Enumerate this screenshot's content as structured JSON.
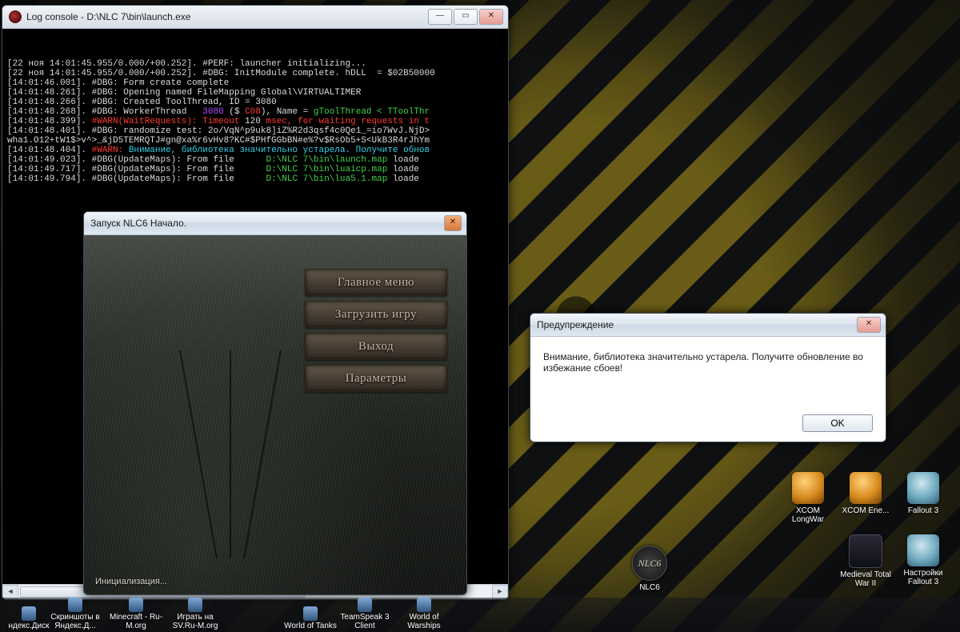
{
  "console": {
    "title": "Log console - D:\\NLC 7\\bin\\launch.exe",
    "lines": [
      {
        "ts": "[22 ноя 14:01:45.955/0.000/+00.252]. ",
        "tag": "#PERF:",
        "tagClass": "c-perf",
        "rest": " launcher initializing..."
      },
      {
        "ts": "[22 ноя 14:01:45.955/0.000/+00.252]. ",
        "tag": "#DBG:",
        "tagClass": "c-dbg",
        "rest": " InitModule complete. hDLL  = $02B50000"
      },
      {
        "ts": "[14:01:46.001]. ",
        "tag": "#DBG:",
        "tagClass": "c-dbg",
        "rest": " Form create complete"
      },
      {
        "ts": "[14:01:48.261]. ",
        "tag": "#DBG:",
        "tagClass": "c-dbg",
        "rest": " Opening named FileMapping Global\\VIRTUALTIMER"
      },
      {
        "ts": "[14:01:48.266]. ",
        "tag": "#DBG:",
        "tagClass": "c-dbg",
        "rest": " Created ToolThread, ID = 3080"
      },
      {
        "ts": "[14:01:48.268]. ",
        "tag": "#DBG:",
        "tagClass": "c-dbg",
        "segments": [
          {
            "t": " WorkerThread   ",
            "c": ""
          },
          {
            "t": "3080",
            "c": "c-num"
          },
          {
            "t": " ($ ",
            "c": ""
          },
          {
            "t": "C08",
            "c": "c-red"
          },
          {
            "t": "), Name = ",
            "c": ""
          },
          {
            "t": "gToolThread < TToolThr",
            "c": "c-name"
          }
        ]
      },
      {
        "ts": "[14:01:48.399]. ",
        "tag": "#WARN(WaitRequests):",
        "tagClass": "c-warn",
        "segments": [
          {
            "t": " Timeout ",
            "c": "c-red"
          },
          {
            "t": "120",
            "c": ""
          },
          {
            "t": " msec, for waiting requests in t",
            "c": "c-red"
          }
        ]
      },
      {
        "ts": "[14:01:48.401]. ",
        "tag": "#DBG:",
        "tagClass": "c-dbg",
        "rest": " randomize test: 2o/VqN^p9uk8]iZ%R2d3qsf4c0Qe1_=io7WvJ.NjD>"
      },
      {
        "ts": "",
        "tag": "",
        "tagClass": "",
        "rest": "wha1.O12+tW1$>v^>_&jD5TEMRQTJ#gn@xa%r6vHv8?KC#$PHfGGbBN#e%?v$RsOb5+S<UkB3R4rJhYm"
      },
      {
        "ts": "[14:01:48.404]. ",
        "tag": "#WARN:",
        "tagClass": "c-warn",
        "segments": [
          {
            "t": " Внимание, библиотека значительно устарела. Получите обнов",
            "c": "c-cyan"
          }
        ]
      },
      {
        "ts": "[14:01:49.023]. ",
        "tag": "#DBG(UpdateMaps):",
        "tagClass": "c-dbg",
        "segments": [
          {
            "t": " From file      ",
            "c": ""
          },
          {
            "t": "D:\\NLC 7\\bin\\launch.map",
            "c": "c-path"
          },
          {
            "t": " loade",
            "c": ""
          }
        ]
      },
      {
        "ts": "[14:01:49.717]. ",
        "tag": "#DBG(UpdateMaps):",
        "tagClass": "c-dbg",
        "segments": [
          {
            "t": " From file      ",
            "c": ""
          },
          {
            "t": "D:\\NLC 7\\bin\\luaicp.map",
            "c": "c-path"
          },
          {
            "t": " loade",
            "c": ""
          }
        ]
      },
      {
        "ts": "[14:01:49.794]. ",
        "tag": "#DBG(UpdateMaps):",
        "tagClass": "c-dbg",
        "segments": [
          {
            "t": " From file      ",
            "c": ""
          },
          {
            "t": "D:\\NLC 7\\bin\\lua5.1.map",
            "c": "c-path"
          },
          {
            "t": " loade",
            "c": ""
          }
        ]
      }
    ]
  },
  "launcher": {
    "title": "Запуск NLC6 Начало.",
    "buttons": {
      "main_menu": "Главное меню",
      "load_game": "Загрузить игру",
      "exit": "Выход",
      "params": "Параметры"
    },
    "status": "Инициализация..."
  },
  "warning": {
    "title": "Предупреждение",
    "message": "Внимание, библиотека значительно устарела. Получите обновление во избежание сбоев!",
    "ok": "OK"
  },
  "desktop_icons": {
    "xcom_longwar": "XCOM LongWar",
    "xcom_ene": "XCOM Ene...",
    "fallout3": "Fallout 3",
    "medieval": "Medieval Total War II",
    "fallout3_settings": "Настройки Fallout 3",
    "nlc6": "NLC6"
  },
  "taskbar": [
    "ндекс.Диск",
    "Скриншоты в Яндекс.Д...",
    "Minecraft - Ru-M.org",
    "Играть на SV.Ru-M.org",
    "World of Tanks",
    "TeamSpeak 3 Client",
    "World of Warships"
  ],
  "window_controls": {
    "minimize": "—",
    "maximize": "▭",
    "close": "✕"
  }
}
